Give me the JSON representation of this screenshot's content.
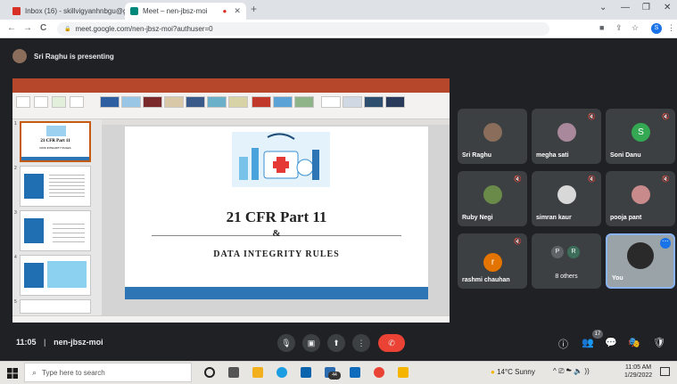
{
  "browser": {
    "tabs": [
      {
        "title": "Inbox (16) - skillvigyanhnbgu@g",
        "icon": "gmail-icon"
      },
      {
        "title": "Meet – nen-jbsz-moi",
        "icon": "meet-icon",
        "recording": "●"
      }
    ],
    "close_glyph": "✕",
    "new_tab": "+",
    "window_controls": {
      "chevron": "⌄",
      "minimize": "—",
      "restore": "❐",
      "close": "✕"
    },
    "nav": {
      "back": "←",
      "forward": "→",
      "reload": "C",
      "lock": "🔒"
    },
    "url": "meet.google.com/nen-jbsz-moi?authuser=0",
    "right_icons": {
      "camera": "■",
      "share": "⇪",
      "bookmark": "☆",
      "menu": "⋮"
    },
    "profile_letter": "S"
  },
  "meet": {
    "presenting_text": "Sri Raghu is presenting",
    "meeting_time": "11:05",
    "meeting_code": "nen-jbsz-moi",
    "people_count": "17",
    "controls": {
      "mic": "🎙",
      "camera": "▣",
      "present": "⬆",
      "more": "⋮",
      "end": "✆"
    },
    "right_controls": {
      "info": "ⓘ",
      "people": "👥",
      "chat": "💬",
      "activities": "🎭",
      "shield": "🛡"
    },
    "participants": [
      {
        "name": "Sri Raghu",
        "muted": false,
        "avatar_color": "#8a6d5a"
      },
      {
        "name": "megha sati",
        "muted": true,
        "avatar_color": "#a8889a"
      },
      {
        "name": "Soni Danu",
        "muted": true,
        "avatar_letter": "S",
        "avatar_color": "#34a853"
      },
      {
        "name": "Ruby Negi",
        "muted": true,
        "avatar_color": "#6a8a4a"
      },
      {
        "name": "simran kaur",
        "muted": true,
        "avatar_color": "#d8d8d8"
      },
      {
        "name": "pooja pant",
        "muted": true,
        "avatar_color": "#c88a8a"
      },
      {
        "name": "rashmi chauhan",
        "muted": true,
        "avatar_letter": "r",
        "avatar_color": "#e37400"
      },
      {
        "name": "8 others",
        "muted": false,
        "avatar_letters": [
          "P",
          "R"
        ],
        "avatar_color": "#5f6368"
      },
      {
        "name": "You",
        "muted": false,
        "avatar_color": "#2a2a2a",
        "more": "⋯"
      }
    ],
    "mute_glyph": "🔇"
  },
  "slide": {
    "title": "21 CFR Part 11",
    "ampersand": "&",
    "subtitle": "DATA INTEGRITY RULES",
    "thumb_title": "21 CFR Part 11",
    "thumb_subtitle": "DATA INTEGRITY RULES",
    "thumb_numbers": [
      "1",
      "2",
      "3",
      "4",
      "5"
    ]
  },
  "taskbar": {
    "search_placeholder": "Type here to search",
    "weather": "14°C  Sunny",
    "tray": "^  ⎚  ☁  🔈  ))",
    "time": "11:05 AM",
    "date": "1/29/2022",
    "notif_badge": "44"
  }
}
